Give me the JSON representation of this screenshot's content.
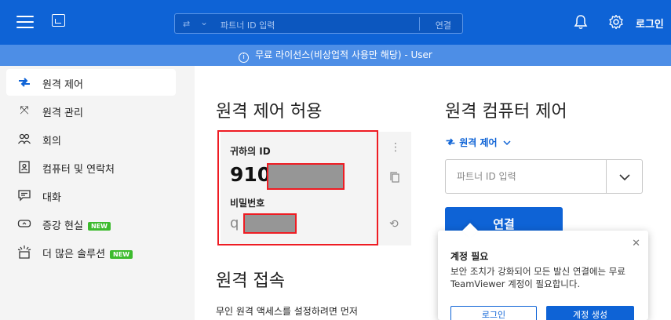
{
  "topbar": {
    "search_placeholder": "파트너 ID 입력",
    "connect_label": "연결",
    "login_label": "로그인"
  },
  "banner": {
    "text": "무료 라이선스(비상업적 사용만 해당) - User"
  },
  "sidebar": {
    "items": [
      {
        "label": "원격 제어",
        "icon": "remote-arrows-icon",
        "active": true
      },
      {
        "label": "원격 관리",
        "icon": "expand-icon"
      },
      {
        "label": "회의",
        "icon": "people-icon"
      },
      {
        "label": "컴퓨터 및 연락처",
        "icon": "contacts-icon"
      },
      {
        "label": "대화",
        "icon": "chat-icon"
      },
      {
        "label": "증강 현실",
        "icon": "ar-glasses-icon",
        "badge": "NEW"
      },
      {
        "label": "더 많은 솔루션",
        "icon": "sparkle-box-icon",
        "badge": "NEW"
      }
    ]
  },
  "allow_remote": {
    "title": "원격 제어 허용",
    "id_label": "귀하의 ID",
    "id_value": "910",
    "password_label": "비밀번호",
    "password_value": "q"
  },
  "unattended": {
    "title": "원격 접속",
    "text": "무인 원격 액세스를 설정하려면 먼저"
  },
  "control_remote": {
    "title": "원격 컴퓨터 제어",
    "mode_label": "원격 제어",
    "partner_placeholder": "파트너 ID 입력",
    "connect_label": "연결"
  },
  "popup": {
    "title": "계정 필요",
    "body": "보안 조치가 강화되어 모든 발신 연결에는 무료 TeamViewer 계정이 필요합니다.",
    "login_label": "로그인",
    "create_label": "계정 생성"
  },
  "colors": {
    "brand": "#0e63d6",
    "banner": "#4d8ee6",
    "badge": "#3dbb2e",
    "highlight": "#ee1c23"
  }
}
